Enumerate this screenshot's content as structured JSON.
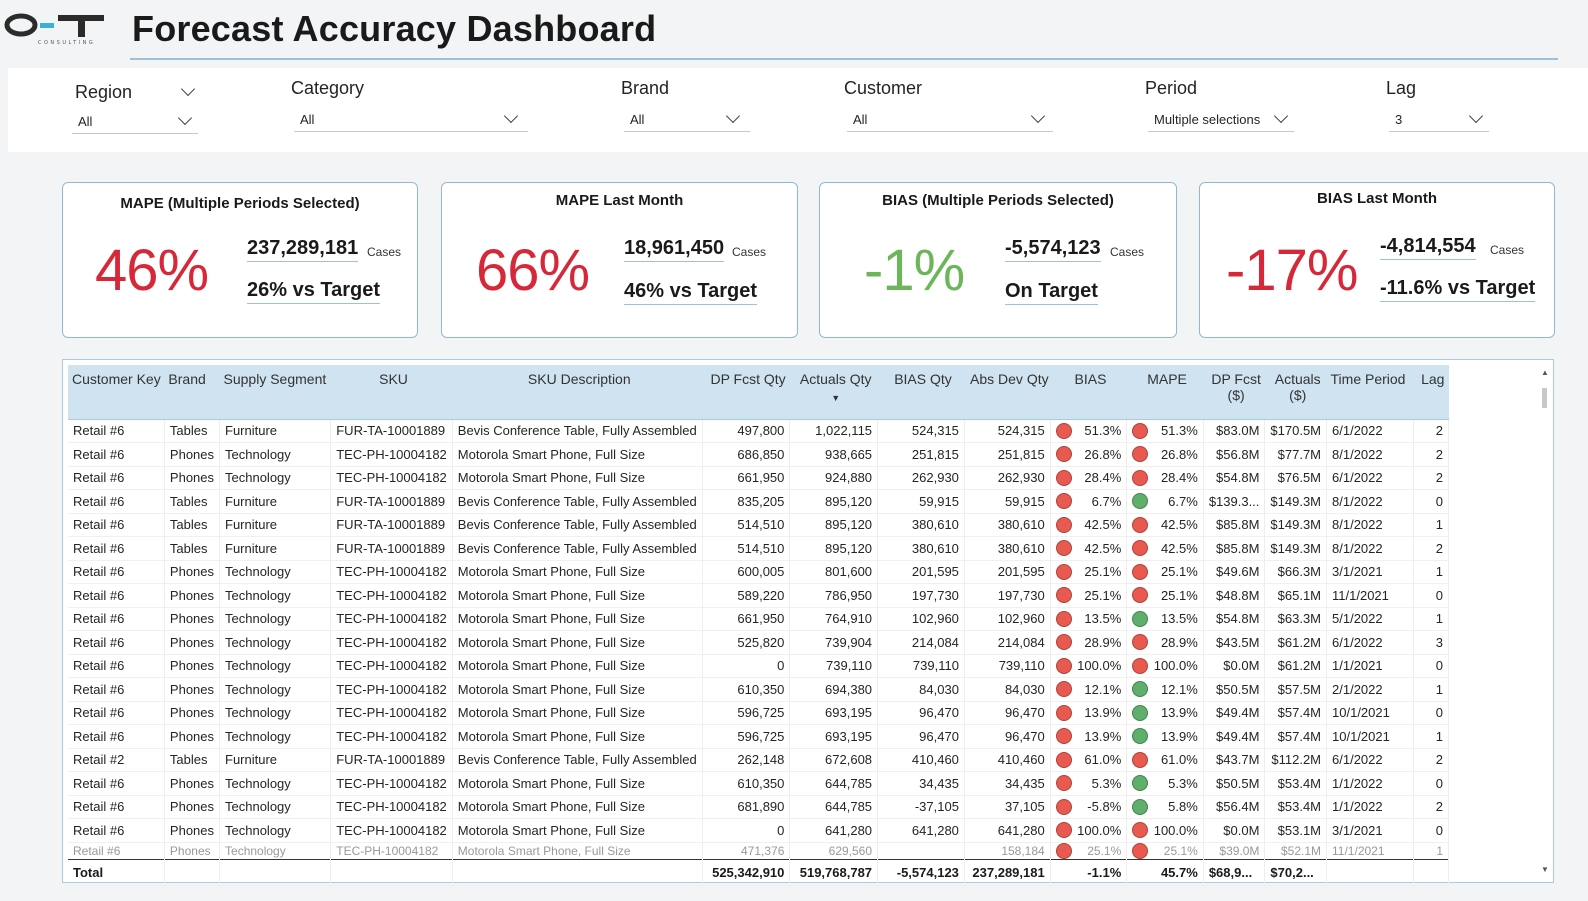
{
  "header": {
    "title": "Forecast Accuracy Dashboard",
    "logo_text": "O-T",
    "logo_sub": "CONSULTING"
  },
  "filters": [
    {
      "label": "Region",
      "value": "All"
    },
    {
      "label": "Category",
      "value": "All"
    },
    {
      "label": "Brand",
      "value": "All"
    },
    {
      "label": "Customer",
      "value": "All"
    },
    {
      "label": "Period",
      "value": "Multiple selections"
    },
    {
      "label": "Lag",
      "value": "3"
    }
  ],
  "cards": [
    {
      "title": "MAPE (Multiple Periods Selected)",
      "big": "46%",
      "big_color": "#d62839",
      "num": "237,289,181",
      "unit": "Cases",
      "sub": "26% vs Target"
    },
    {
      "title": "MAPE Last Month",
      "big": "66%",
      "big_color": "#d62839",
      "num": "18,961,450",
      "unit": "Cases",
      "sub": "46% vs Target"
    },
    {
      "title": "BIAS (Multiple Periods Selected)",
      "big": "-1%",
      "big_color": "#6cb55a",
      "num": "-5,574,123",
      "unit": "Cases",
      "sub": "On Target"
    },
    {
      "title": "BIAS Last Month",
      "big": "-17%",
      "big_color": "#d62839",
      "num": "-4,814,554",
      "unit": "Cases",
      "sub": "-11.6% vs Target"
    }
  ],
  "table": {
    "columns": [
      "Customer Key",
      "Brand",
      "Supply Segment",
      "SKU",
      "SKU Description",
      "DP Fcst Qty",
      "Actuals Qty",
      "BIAS Qty",
      "Abs Dev Qty",
      "BIAS",
      "MAPE",
      "DP Fcst ($)",
      "Actuals ($)",
      "Time Period",
      "Lag"
    ],
    "sort_column": "Actuals Qty",
    "rows": [
      [
        "Retail #6",
        "Tables",
        "Furniture",
        "FUR-TA-10001889",
        "Bevis Conference Table, Fully Assembled",
        "497,800",
        "1,022,115",
        "524,315",
        "524,315",
        "red",
        "51.3%",
        "red",
        "51.3%",
        "$83.0M",
        "$170.5M",
        "6/1/2022",
        "2"
      ],
      [
        "Retail #6",
        "Phones",
        "Technology",
        "TEC-PH-10004182",
        "Motorola Smart Phone, Full Size",
        "686,850",
        "938,665",
        "251,815",
        "251,815",
        "red",
        "26.8%",
        "red",
        "26.8%",
        "$56.8M",
        "$77.7M",
        "8/1/2022",
        "2"
      ],
      [
        "Retail #6",
        "Phones",
        "Technology",
        "TEC-PH-10004182",
        "Motorola Smart Phone, Full Size",
        "661,950",
        "924,880",
        "262,930",
        "262,930",
        "red",
        "28.4%",
        "red",
        "28.4%",
        "$54.8M",
        "$76.5M",
        "6/1/2022",
        "2"
      ],
      [
        "Retail #6",
        "Tables",
        "Furniture",
        "FUR-TA-10001889",
        "Bevis Conference Table, Fully Assembled",
        "835,205",
        "895,120",
        "59,915",
        "59,915",
        "red",
        "6.7%",
        "green",
        "6.7%",
        "$139.3...",
        "$149.3M",
        "8/1/2022",
        "0"
      ],
      [
        "Retail #6",
        "Tables",
        "Furniture",
        "FUR-TA-10001889",
        "Bevis Conference Table, Fully Assembled",
        "514,510",
        "895,120",
        "380,610",
        "380,610",
        "red",
        "42.5%",
        "red",
        "42.5%",
        "$85.8M",
        "$149.3M",
        "8/1/2022",
        "1"
      ],
      [
        "Retail #6",
        "Tables",
        "Furniture",
        "FUR-TA-10001889",
        "Bevis Conference Table, Fully Assembled",
        "514,510",
        "895,120",
        "380,610",
        "380,610",
        "red",
        "42.5%",
        "red",
        "42.5%",
        "$85.8M",
        "$149.3M",
        "8/1/2022",
        "2"
      ],
      [
        "Retail #6",
        "Phones",
        "Technology",
        "TEC-PH-10004182",
        "Motorola Smart Phone, Full Size",
        "600,005",
        "801,600",
        "201,595",
        "201,595",
        "red",
        "25.1%",
        "red",
        "25.1%",
        "$49.6M",
        "$66.3M",
        "3/1/2021",
        "1"
      ],
      [
        "Retail #6",
        "Phones",
        "Technology",
        "TEC-PH-10004182",
        "Motorola Smart Phone, Full Size",
        "589,220",
        "786,950",
        "197,730",
        "197,730",
        "red",
        "25.1%",
        "red",
        "25.1%",
        "$48.8M",
        "$65.1M",
        "11/1/2021",
        "0"
      ],
      [
        "Retail #6",
        "Phones",
        "Technology",
        "TEC-PH-10004182",
        "Motorola Smart Phone, Full Size",
        "661,950",
        "764,910",
        "102,960",
        "102,960",
        "red",
        "13.5%",
        "green",
        "13.5%",
        "$54.8M",
        "$63.3M",
        "5/1/2022",
        "1"
      ],
      [
        "Retail #6",
        "Phones",
        "Technology",
        "TEC-PH-10004182",
        "Motorola Smart Phone, Full Size",
        "525,820",
        "739,904",
        "214,084",
        "214,084",
        "red",
        "28.9%",
        "red",
        "28.9%",
        "$43.5M",
        "$61.2M",
        "6/1/2022",
        "3"
      ],
      [
        "Retail #6",
        "Phones",
        "Technology",
        "TEC-PH-10004182",
        "Motorola Smart Phone, Full Size",
        "0",
        "739,110",
        "739,110",
        "739,110",
        "red",
        "100.0%",
        "red",
        "100.0%",
        "$0.0M",
        "$61.2M",
        "1/1/2021",
        "0"
      ],
      [
        "Retail #6",
        "Phones",
        "Technology",
        "TEC-PH-10004182",
        "Motorola Smart Phone, Full Size",
        "610,350",
        "694,380",
        "84,030",
        "84,030",
        "red",
        "12.1%",
        "green",
        "12.1%",
        "$50.5M",
        "$57.5M",
        "2/1/2022",
        "1"
      ],
      [
        "Retail #6",
        "Phones",
        "Technology",
        "TEC-PH-10004182",
        "Motorola Smart Phone, Full Size",
        "596,725",
        "693,195",
        "96,470",
        "96,470",
        "red",
        "13.9%",
        "green",
        "13.9%",
        "$49.4M",
        "$57.4M",
        "10/1/2021",
        "0"
      ],
      [
        "Retail #6",
        "Phones",
        "Technology",
        "TEC-PH-10004182",
        "Motorola Smart Phone, Full Size",
        "596,725",
        "693,195",
        "96,470",
        "96,470",
        "red",
        "13.9%",
        "green",
        "13.9%",
        "$49.4M",
        "$57.4M",
        "10/1/2021",
        "1"
      ],
      [
        "Retail #2",
        "Tables",
        "Furniture",
        "FUR-TA-10001889",
        "Bevis Conference Table, Fully Assembled",
        "262,148",
        "672,608",
        "410,460",
        "410,460",
        "red",
        "61.0%",
        "red",
        "61.0%",
        "$43.7M",
        "$112.2M",
        "6/1/2022",
        "2"
      ],
      [
        "Retail #6",
        "Phones",
        "Technology",
        "TEC-PH-10004182",
        "Motorola Smart Phone, Full Size",
        "610,350",
        "644,785",
        "34,435",
        "34,435",
        "red",
        "5.3%",
        "green",
        "5.3%",
        "$50.5M",
        "$53.4M",
        "1/1/2022",
        "0"
      ],
      [
        "Retail #6",
        "Phones",
        "Technology",
        "TEC-PH-10004182",
        "Motorola Smart Phone, Full Size",
        "681,890",
        "644,785",
        "-37,105",
        "37,105",
        "red",
        "-5.8%",
        "green",
        "5.8%",
        "$56.4M",
        "$53.4M",
        "1/1/2022",
        "2"
      ],
      [
        "Retail #6",
        "Phones",
        "Technology",
        "TEC-PH-10004182",
        "Motorola Smart Phone, Full Size",
        "0",
        "641,280",
        "641,280",
        "641,280",
        "red",
        "100.0%",
        "red",
        "100.0%",
        "$0.0M",
        "$53.1M",
        "3/1/2021",
        "0"
      ]
    ],
    "partial_row": [
      "Retail #6",
      "Phones",
      "Technology",
      "TEC-PH-10004182",
      "Motorola Smart Phone, Full Size",
      "471,376",
      "629,560",
      "",
      "158,184",
      "red",
      "25.1%",
      "red",
      "25.1%",
      "$39.0M",
      "$52.1M",
      "11/1/2021",
      "1"
    ],
    "total": {
      "label": "Total",
      "dp_fcst_qty": "525,342,910",
      "actuals_qty": "519,768,787",
      "bias_qty": "-5,574,123",
      "abs_dev_qty": "237,289,181",
      "bias": "-1.1%",
      "mape": "45.7%",
      "dp_fcst_usd": "$68,9...",
      "actuals_usd": "$70,2..."
    }
  },
  "colors": {
    "red_status": "#e8594f",
    "green_status": "#5fae6c",
    "header_bg": "#cfe3f0",
    "accent": "#9dc1d8"
  }
}
